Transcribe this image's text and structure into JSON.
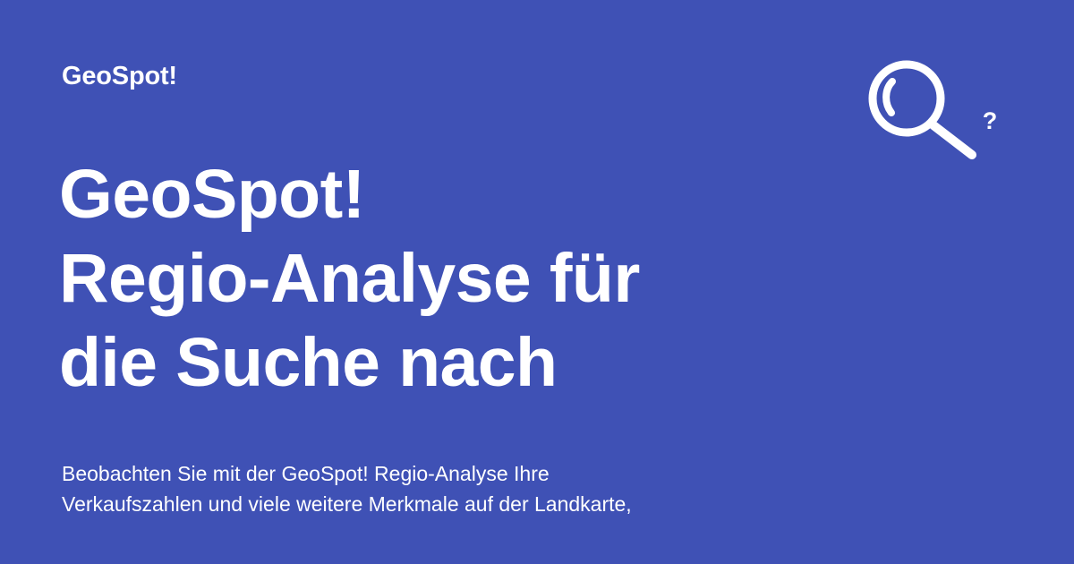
{
  "brand": {
    "name": "GeoSpot!"
  },
  "headline": {
    "lines": [
      "GeoSpot!",
      "Regio-Analyse für",
      "die Suche nach"
    ]
  },
  "description": {
    "lines": [
      "Beobachten Sie mit der GeoSpot! Regio-Analyse Ihre",
      "Verkaufszahlen und viele weitere Merkmale auf der Landkarte,"
    ]
  },
  "graphic": {
    "icon": "magnifying-glass-question-icon",
    "question_mark": "?"
  },
  "colors": {
    "background": "#3f51b5",
    "foreground": "#ffffff"
  }
}
